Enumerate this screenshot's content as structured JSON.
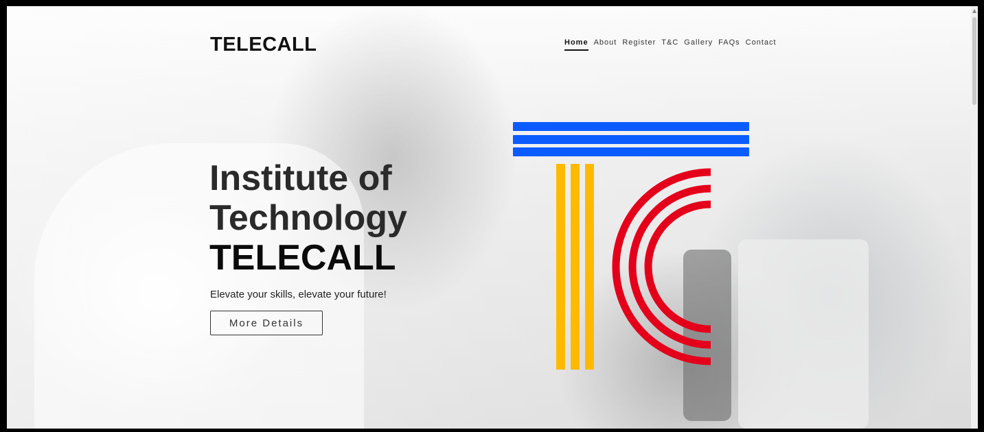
{
  "brand": {
    "name": "TELECALL"
  },
  "nav": {
    "items": [
      {
        "label": "Home",
        "active": true
      },
      {
        "label": "About"
      },
      {
        "label": "Register"
      },
      {
        "label": "T&C"
      },
      {
        "label": "Gallery"
      },
      {
        "label": "FAQs"
      },
      {
        "label": "Contact"
      }
    ]
  },
  "hero": {
    "headline_line1": "Institute of",
    "headline_line2": "Technology",
    "headline_line3": "TELECALL",
    "tagline": "Elevate your skills, elevate your future!",
    "cta_label": "More Details"
  },
  "logo": {
    "bar_color": "#0b5cff",
    "column_color": "#ffba00",
    "arc_color": "#e4001b",
    "icon": "tc-logo"
  },
  "icons": {
    "scroll_up": "scroll-up-arrow-icon"
  }
}
